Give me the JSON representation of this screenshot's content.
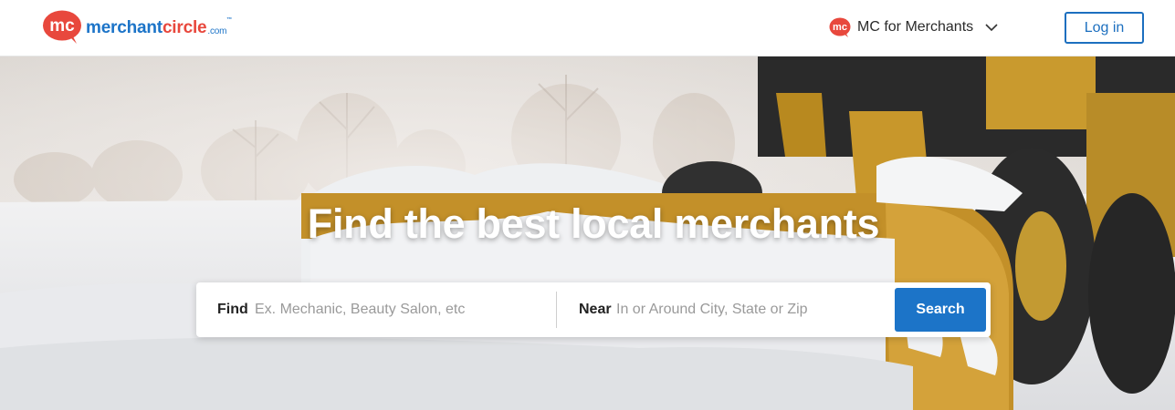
{
  "brand": {
    "badge_text": "mc",
    "name_part1": "merchant",
    "name_part2": "circle",
    "domain": ".com",
    "trademark": "™",
    "colors": {
      "blue": "#1c74c8",
      "red": "#e8483d"
    }
  },
  "nav": {
    "merchants_badge": "mc",
    "merchants_label": "MC for Merchants",
    "dropdown_icon": "chevron-down-icon",
    "login_label": "Log in"
  },
  "hero": {
    "title": "Find the best local merchants",
    "background": "snow-plow-loader-photo"
  },
  "search": {
    "find_label": "Find",
    "find_placeholder": "Ex. Mechanic, Beauty Salon, etc",
    "find_value": "",
    "near_label": "Near",
    "near_placeholder": "In or Around City, State or Zip",
    "near_value": "",
    "button_label": "Search"
  }
}
